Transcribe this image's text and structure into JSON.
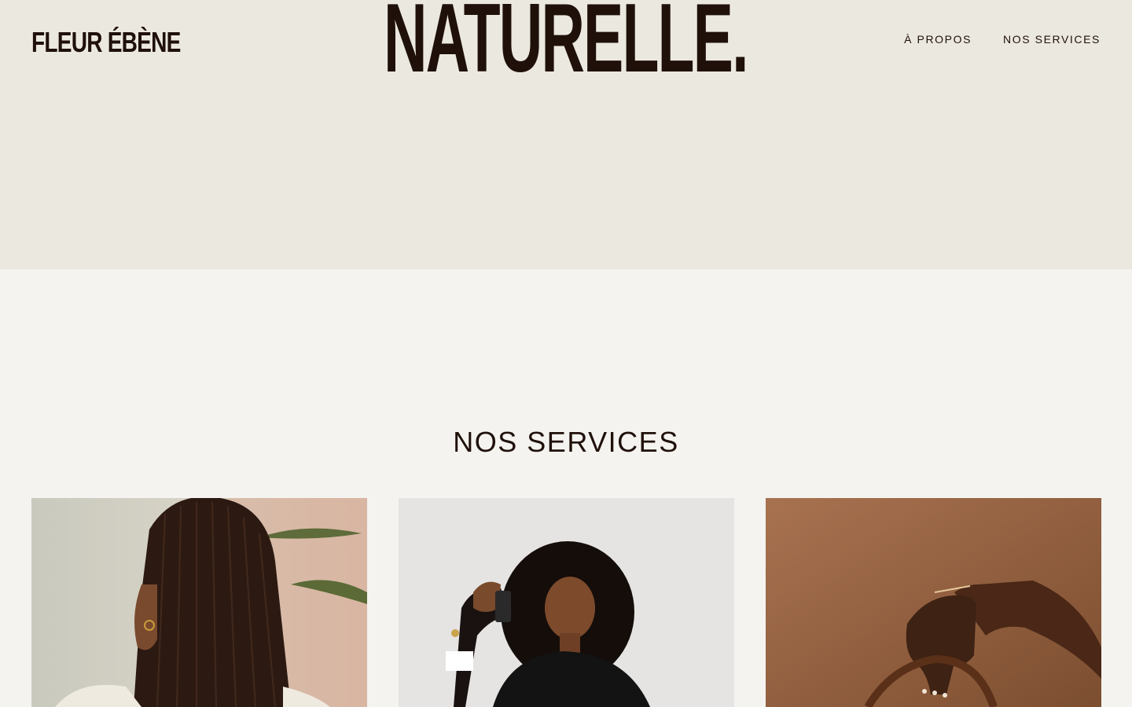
{
  "header": {
    "logo": "FLEUR ÉBÈNE",
    "hero_word": "NATURELLE.",
    "nav": [
      {
        "label": "À PROPOS"
      },
      {
        "label": "NOS SERVICES"
      }
    ]
  },
  "services": {
    "title": "NOS SERVICES"
  },
  "colors": {
    "hero_bg": "#ebe8e0",
    "page_bg": "#f4f3ef",
    "text_dark": "#1f100a",
    "card3_bg": "#8a5a3a"
  }
}
